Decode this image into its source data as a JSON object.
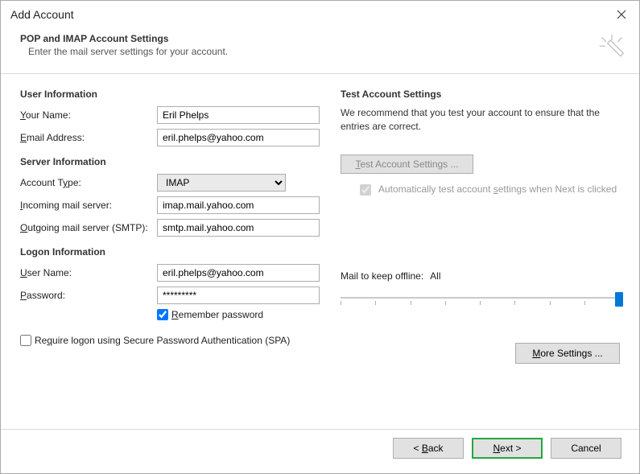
{
  "window": {
    "title": "Add Account"
  },
  "header": {
    "title": "POP and IMAP Account Settings",
    "subtitle": "Enter the mail server settings for your account."
  },
  "left": {
    "section_user": "User Information",
    "your_name_label_pre": "Y",
    "your_name_label_post": "our Name:",
    "your_name_value": "Eril Phelps",
    "email_label_pre": "E",
    "email_label_post": "mail Address:",
    "email_value": "eril.phelps@yahoo.com",
    "section_server": "Server Information",
    "account_type_label_pre": "Account T",
    "account_type_label_u": "y",
    "account_type_label_post": "pe:",
    "account_type_value": "IMAP",
    "incoming_label_pre": "I",
    "incoming_label_post": "ncoming mail server:",
    "incoming_value": "imap.mail.yahoo.com",
    "outgoing_label_pre": "O",
    "outgoing_label_post": "utgoing mail server (SMTP):",
    "outgoing_value": "smtp.mail.yahoo.com",
    "section_logon": "Logon Information",
    "user_label_pre": "U",
    "user_label_post": "ser Name:",
    "user_value": "eril.phelps@yahoo.com",
    "pass_label_pre": "P",
    "pass_label_post": "assword:",
    "pass_value": "*********",
    "remember_pre": "R",
    "remember_post": "emember password",
    "spa_pre": "Re",
    "spa_u": "q",
    "spa_post": "uire logon using Secure Password Authentication (SPA)"
  },
  "right": {
    "section_test": "Test Account Settings",
    "test_desc": "We recommend that you test your account to ensure that the entries are correct.",
    "test_btn_pre": "T",
    "test_btn_post": "est Account Settings ...",
    "auto_test_pre": "Automatically test account ",
    "auto_test_u": "s",
    "auto_test_post": "ettings when Next is clicked",
    "mail_offline_label": "Mail to keep offline:",
    "mail_offline_value": "All",
    "more_pre": "M",
    "more_post": "ore Settings ..."
  },
  "footer": {
    "back_pre": "< ",
    "back_u": "B",
    "back_post": "ack",
    "next_pre": "N",
    "next_post": "ext >",
    "cancel": "Cancel"
  }
}
